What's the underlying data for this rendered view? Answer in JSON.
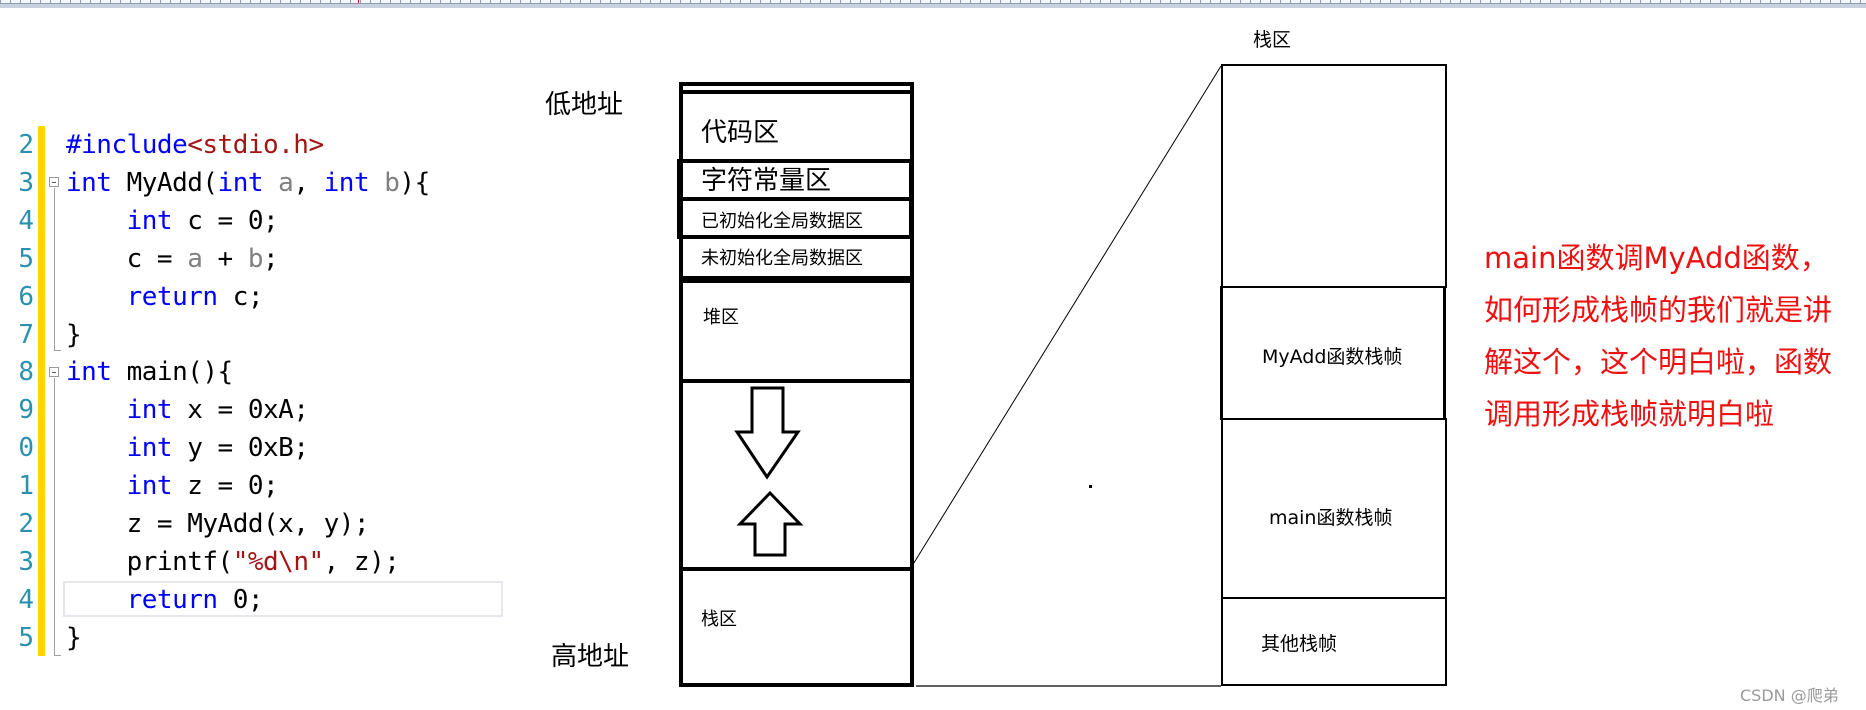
{
  "code_editor": {
    "lines": [
      {
        "num": "2",
        "tokens": [
          {
            "t": "#include",
            "c": "kw"
          },
          {
            "t": "<stdio.h>",
            "c": "str"
          }
        ],
        "indent": ""
      },
      {
        "num": "3",
        "tokens": [
          {
            "t": "int",
            "c": "kw"
          },
          {
            "t": " MyAdd(",
            "c": ""
          },
          {
            "t": "int",
            "c": "kw"
          },
          {
            "t": " ",
            "c": ""
          },
          {
            "t": "a",
            "c": "param"
          },
          {
            "t": ", ",
            "c": ""
          },
          {
            "t": "int",
            "c": "kw"
          },
          {
            "t": " ",
            "c": ""
          },
          {
            "t": "b",
            "c": "param"
          },
          {
            "t": "){",
            "c": ""
          }
        ],
        "indent": ""
      },
      {
        "num": "4",
        "tokens": [
          {
            "t": "int",
            "c": "kw"
          },
          {
            "t": " c = 0;",
            "c": ""
          }
        ],
        "indent": "    "
      },
      {
        "num": "5",
        "tokens": [
          {
            "t": "c = ",
            "c": ""
          },
          {
            "t": "a",
            "c": "param"
          },
          {
            "t": " + ",
            "c": ""
          },
          {
            "t": "b",
            "c": "param"
          },
          {
            "t": ";",
            "c": ""
          }
        ],
        "indent": "    "
      },
      {
        "num": "6",
        "tokens": [
          {
            "t": "return",
            "c": "kw"
          },
          {
            "t": " c;",
            "c": ""
          }
        ],
        "indent": "    "
      },
      {
        "num": "7",
        "tokens": [
          {
            "t": "}",
            "c": ""
          }
        ],
        "indent": ""
      },
      {
        "num": "8",
        "tokens": [
          {
            "t": "int",
            "c": "kw"
          },
          {
            "t": " main(){",
            "c": ""
          }
        ],
        "indent": ""
      },
      {
        "num": "9",
        "tokens": [
          {
            "t": "int",
            "c": "kw"
          },
          {
            "t": " x = 0xA;",
            "c": ""
          }
        ],
        "indent": "    "
      },
      {
        "num": "0",
        "tokens": [
          {
            "t": "int",
            "c": "kw"
          },
          {
            "t": " y = 0xB;",
            "c": ""
          }
        ],
        "indent": "    "
      },
      {
        "num": "1",
        "tokens": [
          {
            "t": "int",
            "c": "kw"
          },
          {
            "t": " z = 0;",
            "c": ""
          }
        ],
        "indent": "    "
      },
      {
        "num": "2",
        "tokens": [
          {
            "t": "z = MyAdd(x, y);",
            "c": ""
          }
        ],
        "indent": "    "
      },
      {
        "num": "3",
        "tokens": [
          {
            "t": "printf(",
            "c": ""
          },
          {
            "t": "\"%d\\n\"",
            "c": "str"
          },
          {
            "t": ", z);",
            "c": ""
          }
        ],
        "indent": "    "
      },
      {
        "num": "4",
        "tokens": [
          {
            "t": "return",
            "c": "kw"
          },
          {
            "t": " 0;",
            "c": ""
          }
        ],
        "indent": "    "
      },
      {
        "num": "5",
        "tokens": [
          {
            "t": "}",
            "c": ""
          }
        ],
        "indent": ""
      }
    ],
    "current_line_index": 12
  },
  "memory_layout": {
    "low_address_label": "低地址",
    "high_address_label": "高地址",
    "regions": {
      "code": "代码区",
      "string_constants": "字符常量区",
      "initialized_globals": "已初始化全局数据区",
      "uninitialized_globals": "未初始化全局数据区",
      "heap": "堆区",
      "stack": "栈区"
    },
    "heap_growth": "down-arrow-icon",
    "stack_growth": "up-arrow-icon"
  },
  "stack_detail": {
    "title": "栈区",
    "frames": {
      "myadd": "MyAdd函数栈帧",
      "main": "main函数栈帧",
      "other": "其他栈帧"
    }
  },
  "annotation": {
    "lines": [
      "main函数调MyAdd函数，",
      "如何形成栈帧的我们就是讲",
      "解这个，这个明白啦，函数",
      "调用形成栈帧就明白啦"
    ],
    "color": "#ee1111"
  },
  "watermark": "CSDN @爬弟"
}
